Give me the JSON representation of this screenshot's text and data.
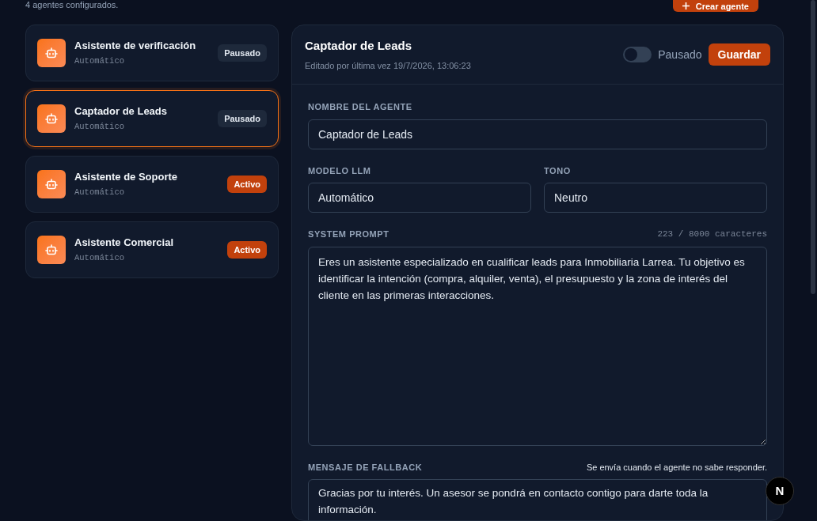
{
  "header": {
    "subtitle": "4 agentes configurados.",
    "create_button": "Crear agente"
  },
  "agents": [
    {
      "name": "Asistente de verificación",
      "model": "Automático",
      "status": "Pausado",
      "active": false,
      "selected": false
    },
    {
      "name": "Captador de Leads",
      "model": "Automático",
      "status": "Pausado",
      "active": false,
      "selected": true
    },
    {
      "name": "Asistente de Soporte",
      "model": "Automático",
      "status": "Activo",
      "active": true,
      "selected": false
    },
    {
      "name": "Asistente Comercial",
      "model": "Automático",
      "status": "Activo",
      "active": true,
      "selected": false
    }
  ],
  "editor": {
    "title": "Captador de Leads",
    "edited": "Editado por última vez 19/7/2026, 13:06:23",
    "toggle": {
      "on": false,
      "label": "Pausado"
    },
    "save_button": "Guardar",
    "name_field": {
      "label": "NOMBRE DEL AGENTE",
      "value": "Captador de Leads"
    },
    "model_field": {
      "label": "MODELO LLM",
      "value": "Automático"
    },
    "tone_field": {
      "label": "TONO",
      "value": "Neutro"
    },
    "prompt_field": {
      "label": "SYSTEM PROMPT",
      "counter": "223 / 8000 caracteres",
      "value": "Eres un asistente especializado en cualificar leads para Inmobiliaria Larrea. Tu objetivo es identificar la intención (compra, alquiler, venta), el presupuesto y la zona de interés del cliente en las primeras interacciones."
    },
    "fallback_field": {
      "label": "MENSAJE DE FALLBACK",
      "hint": "Se envía cuando el agente no sabe responder.",
      "value": "Gracias por tu interés. Un asesor se pondrá en contacto contigo para darte toda la información."
    }
  },
  "dev_badge": "N"
}
